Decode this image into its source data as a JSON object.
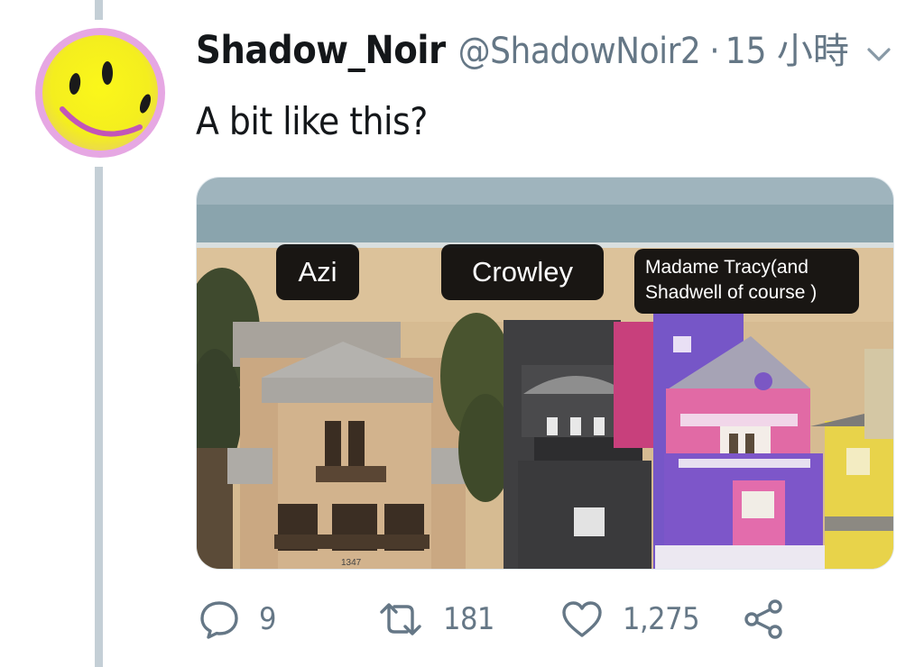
{
  "tweet": {
    "author_name": "Shadow_Noir",
    "handle": "@ShadowNoir2",
    "separator": "·",
    "time": "15 小時",
    "text": "A bit like this?"
  },
  "media": {
    "labels": {
      "azi": "Azi",
      "crowley": "Crowley",
      "tracy_line1": "Madame Tracy(and",
      "tracy_line2": "Shadwell of course )"
    },
    "house_number": "1347"
  },
  "actions": {
    "reply_count": "9",
    "retweet_count": "181",
    "like_count": "1,275"
  },
  "icons": {
    "avatar": "smiley-face-icon",
    "menu": "chevron-down-icon",
    "reply": "reply-icon",
    "retweet": "retweet-icon",
    "like": "heart-icon",
    "share": "share-icon"
  },
  "colors": {
    "text_primary": "#14171a",
    "text_secondary": "#657786",
    "thread_line": "#c4cfd6",
    "avatar_face": "#f7f01c",
    "avatar_ring": "#d97fd6"
  }
}
